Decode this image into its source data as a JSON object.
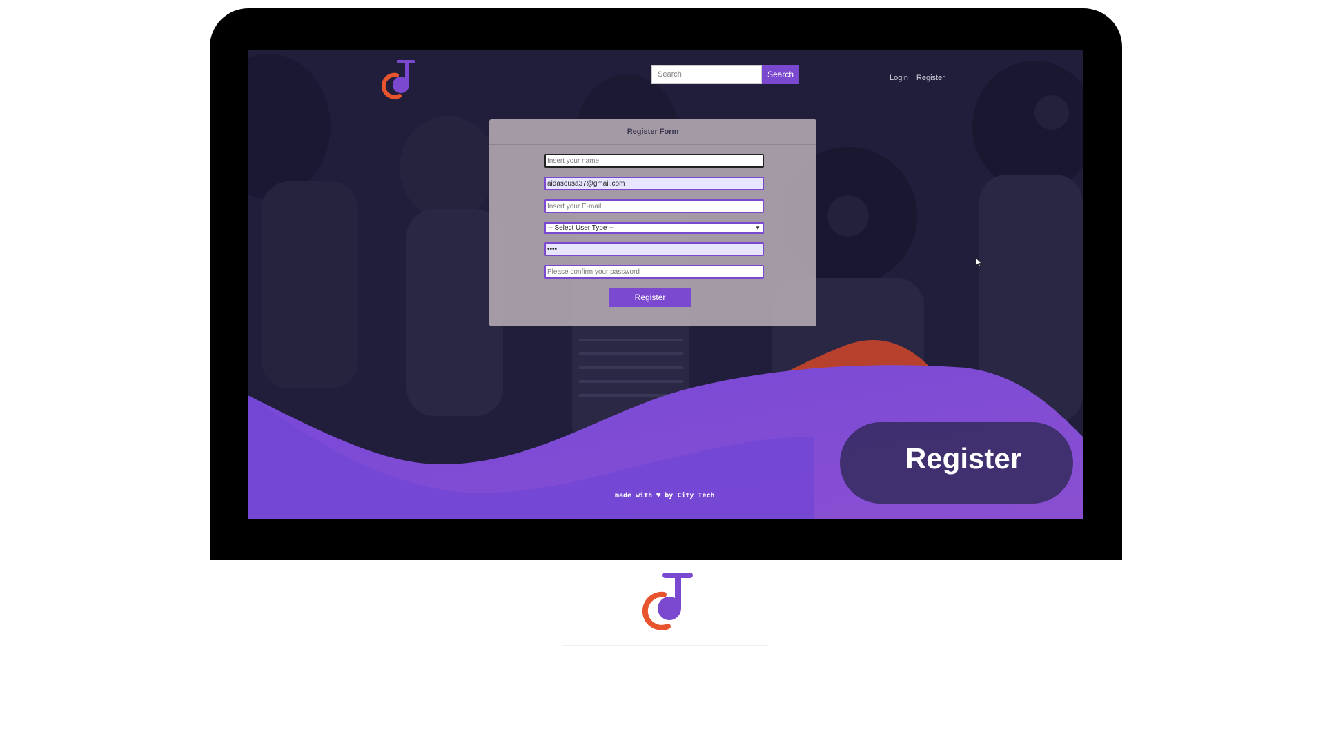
{
  "header": {
    "search_placeholder": "Search",
    "search_button": "Search",
    "nav": {
      "login": "Login",
      "register": "Register"
    }
  },
  "form": {
    "title": "Register Form",
    "name_placeholder": "Insert your name",
    "username_value": "aidasousa37@gmail.com",
    "email_placeholder": "Insert your E-mail",
    "user_type_selected": "-- Select User Type --",
    "password_value": "••••",
    "confirm_password_placeholder": "Please confirm your password",
    "submit": "Register"
  },
  "footer": {
    "before": "made with ",
    "heart": "♥",
    "after": " by City Tech"
  },
  "overlay_label": "Register",
  "icons": {
    "logo": "music-note-cj-logo",
    "heart": "heart-icon",
    "cursor": "mouse-cursor-icon"
  },
  "colors": {
    "accent_purple": "#7b48d0",
    "accent_orange": "#e8542e",
    "background_dark": "#201d3b"
  }
}
